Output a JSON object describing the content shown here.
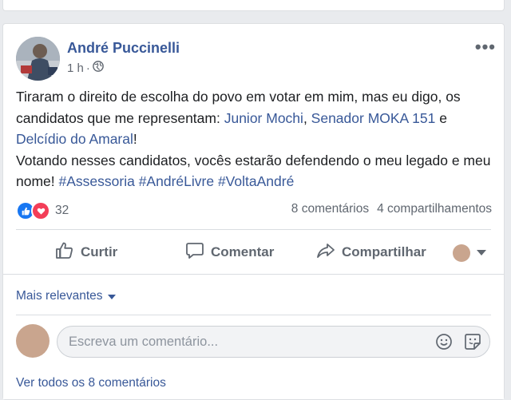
{
  "post": {
    "author": "André Puccinelli",
    "time": "1 h",
    "separator": "·",
    "text": {
      "line1": "Tiraram o direito de escolha do povo em votar em mim, mas eu digo, os candidatos que me representam: ",
      "link1": "Junior Mochi",
      "sep1": ", ",
      "link2": "Senador MOKA 151",
      "sep2": " e ",
      "link3": "Delcídio do Amaral",
      "after": "!",
      "line2": "Votando nesses candidatos, vocês estarão defendendo o meu legado e meu nome! ",
      "hashtag1": "#Assessoria",
      "hashtag2": "#AndréLivre",
      "hashtag3": "#VoltaAndré"
    },
    "reaction_count": "32",
    "comments_count": "8 comentários",
    "shares_count": "4 compartilhamentos"
  },
  "actions": {
    "like": "Curtir",
    "comment": "Comentar",
    "share": "Compartilhar"
  },
  "comments": {
    "sort_label": "Mais relevantes",
    "input_placeholder": "Escreva um comentário...",
    "see_all": "Ver todos os 8 comentários"
  },
  "colors": {
    "link": "#385898",
    "like": "#1877f2",
    "love": "#f33e58"
  },
  "icons": [
    "globe-icon",
    "more-icon",
    "like-icon",
    "love-icon",
    "thumb-icon",
    "comment-bubble-icon",
    "share-arrow-icon",
    "caret-down-icon",
    "emoji-icon",
    "sticker-icon"
  ]
}
